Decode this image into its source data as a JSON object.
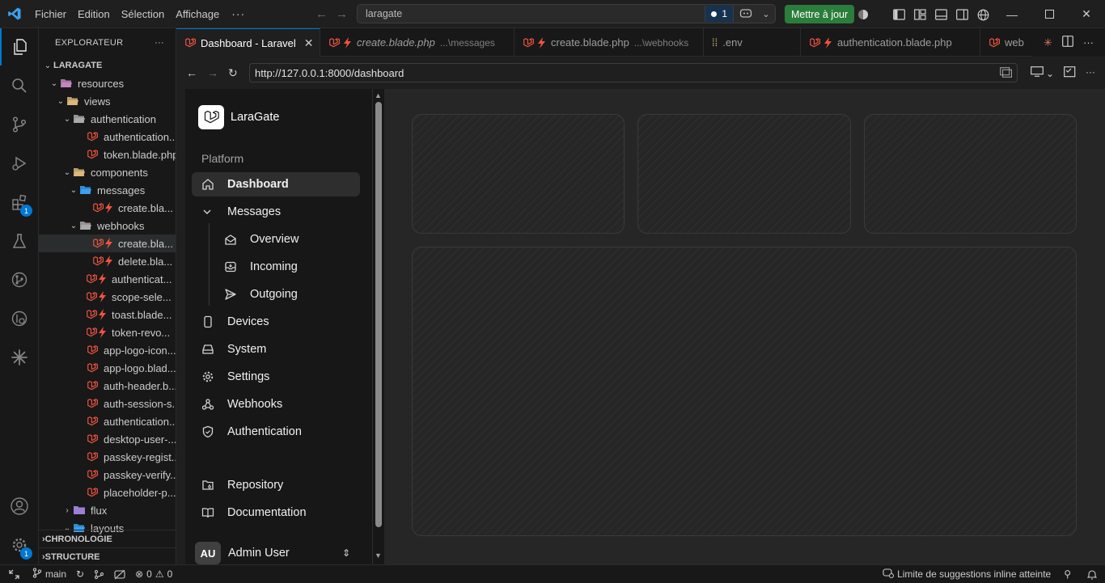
{
  "titlebar": {
    "menu": [
      "Fichier",
      "Edition",
      "Sélection",
      "Affichage"
    ],
    "more": "···",
    "search": "laragate",
    "chat_count": "1",
    "update_button": "Mettre à jour"
  },
  "explorer": {
    "title": "EXPLORATEUR",
    "more": "···",
    "root": "LARAGATE",
    "rows": [
      {
        "label": "resources",
        "indent": 1,
        "type": "folder-open",
        "color": "#c586c0"
      },
      {
        "label": "views",
        "indent": 2,
        "type": "folder-open",
        "color": "#dcb67a"
      },
      {
        "label": "authentication",
        "indent": 3,
        "type": "folder-open",
        "color": "#aaaaaa"
      },
      {
        "label": "authentication...",
        "indent": 4,
        "type": "blade",
        "color": "#f05340"
      },
      {
        "label": "token.blade.php",
        "indent": 4,
        "type": "blade",
        "color": "#f05340"
      },
      {
        "label": "components",
        "indent": 3,
        "type": "folder-open",
        "color": "#dcb67a"
      },
      {
        "label": "messages",
        "indent": 4,
        "type": "folder-open",
        "color": "#3aa0f0"
      },
      {
        "label": "create.bla...",
        "indent": 5,
        "type": "livewire",
        "color": "#f05340"
      },
      {
        "label": "webhooks",
        "indent": 4,
        "type": "folder-open",
        "color": "#aaaaaa"
      },
      {
        "label": "create.bla...",
        "indent": 5,
        "type": "livewire",
        "color": "#f05340"
      },
      {
        "label": "delete.bla...",
        "indent": 5,
        "type": "livewire",
        "color": "#f05340"
      },
      {
        "label": "authenticat...",
        "indent": 4,
        "type": "livewire",
        "color": "#f05340"
      },
      {
        "label": "scope-sele...",
        "indent": 4,
        "type": "livewire",
        "color": "#f05340"
      },
      {
        "label": "toast.blade...",
        "indent": 4,
        "type": "livewire",
        "color": "#f05340"
      },
      {
        "label": "token-revo...",
        "indent": 4,
        "type": "livewire",
        "color": "#f05340"
      },
      {
        "label": "app-logo-icon...",
        "indent": 4,
        "type": "blade",
        "color": "#f05340"
      },
      {
        "label": "app-logo.blad...",
        "indent": 4,
        "type": "blade",
        "color": "#f05340"
      },
      {
        "label": "auth-header.b...",
        "indent": 4,
        "type": "blade",
        "color": "#f05340"
      },
      {
        "label": "auth-session-s...",
        "indent": 4,
        "type": "blade",
        "color": "#f05340"
      },
      {
        "label": "authentication...",
        "indent": 4,
        "type": "blade",
        "color": "#f05340"
      },
      {
        "label": "desktop-user-...",
        "indent": 4,
        "type": "blade",
        "color": "#f05340"
      },
      {
        "label": "passkey-regist...",
        "indent": 4,
        "type": "blade",
        "color": "#f05340"
      },
      {
        "label": "passkey-verify...",
        "indent": 4,
        "type": "blade",
        "color": "#f05340"
      },
      {
        "label": "placeholder-p...",
        "indent": 4,
        "type": "blade",
        "color": "#f05340"
      },
      {
        "label": "flux",
        "indent": 3,
        "type": "folder-closed",
        "color": "#9b7fd4"
      },
      {
        "label": "layouts",
        "indent": 3,
        "type": "folder-open",
        "color": "#3aa0f0"
      }
    ],
    "sections": [
      "CHRONOLOGIE",
      "STRUCTURE"
    ]
  },
  "tabs": [
    {
      "label": "Dashboard - Laravel",
      "desc": "",
      "active": true,
      "italic": false
    },
    {
      "label": "create.blade.php",
      "desc": "...\\messages",
      "active": false,
      "italic": true
    },
    {
      "label": "create.blade.php",
      "desc": "...\\webhooks",
      "active": false,
      "italic": false
    },
    {
      "label": ".env",
      "desc": "",
      "active": false,
      "italic": false
    },
    {
      "label": "authentication.blade.php",
      "desc": "",
      "active": false,
      "italic": false
    },
    {
      "label": "web",
      "desc": "",
      "active": false,
      "italic": false
    }
  ],
  "browser": {
    "url": "http://127.0.0.1:8000/dashboard"
  },
  "app": {
    "brand": "LaraGate",
    "nav_heading": "Platform",
    "nav": [
      {
        "label": "Dashboard",
        "icon": "home-icon",
        "sub": false,
        "active": true
      },
      {
        "label": "Messages",
        "icon": "chevron-down-icon",
        "sub": false,
        "active": false
      },
      {
        "label": "Overview",
        "icon": "envelope-open-icon",
        "sub": true,
        "active": false
      },
      {
        "label": "Incoming",
        "icon": "inbox-icon",
        "sub": true,
        "active": false
      },
      {
        "label": "Outgoing",
        "icon": "send-icon",
        "sub": true,
        "active": false
      },
      {
        "label": "Devices",
        "icon": "phone-icon",
        "sub": false,
        "active": false
      },
      {
        "label": "System",
        "icon": "server-icon",
        "sub": false,
        "active": false
      },
      {
        "label": "Settings",
        "icon": "gear-icon",
        "sub": false,
        "active": false
      },
      {
        "label": "Webhooks",
        "icon": "webhook-icon",
        "sub": false,
        "active": false
      },
      {
        "label": "Authentication",
        "icon": "shield-icon",
        "sub": false,
        "active": false
      }
    ],
    "bottom_nav": [
      {
        "label": "Repository",
        "icon": "folder-git-icon"
      },
      {
        "label": "Documentation",
        "icon": "book-open-icon"
      }
    ],
    "user": {
      "initials": "AU",
      "name": "Admin User"
    }
  },
  "statusbar": {
    "branch": "main",
    "errors": "0",
    "warnings": "0",
    "copilot_status": "Limite de suggestions inline atteinte"
  },
  "colors": {
    "accent": "#0078d4",
    "update_green": "#2a7d3a",
    "laravel_red": "#f05340"
  }
}
